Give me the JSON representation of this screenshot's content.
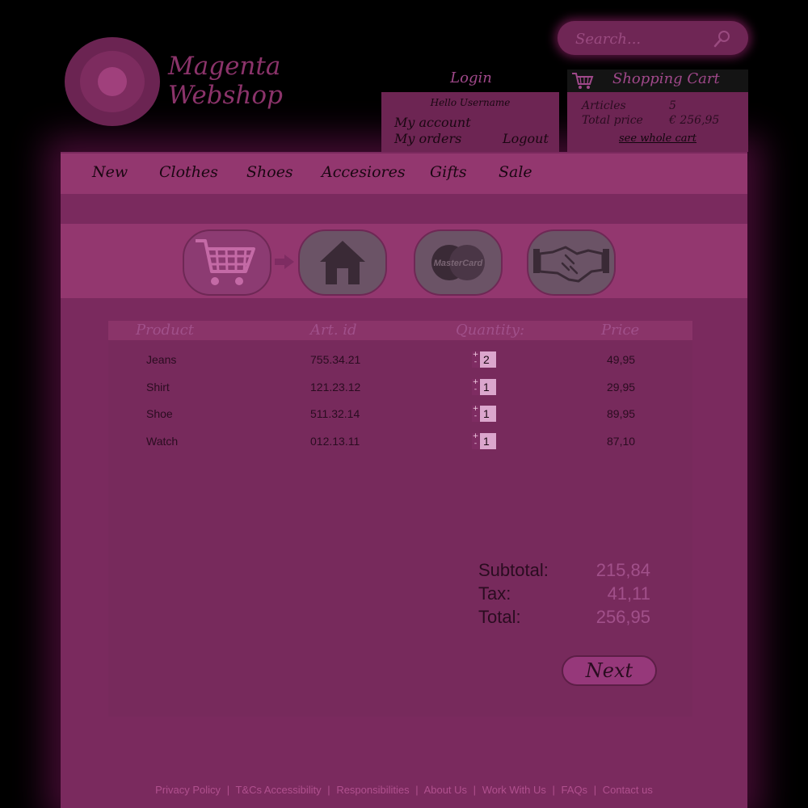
{
  "header": {
    "logo_line1": "Magenta",
    "logo_line2": "Webshop",
    "search_placeholder": "Search..."
  },
  "login": {
    "title": "Login",
    "greeting": "Hello Username",
    "my_account": "My account",
    "my_orders": "My orders",
    "logout": "Logout"
  },
  "cart": {
    "title": "Shopping Cart",
    "articles_label": "Articles",
    "articles_value": "5",
    "total_label": "Total price",
    "total_value": "€ 256,95",
    "see_whole_cart": "see whole cart"
  },
  "nav": {
    "items": [
      "New",
      "Clothes",
      "Shoes",
      "Accesiores",
      "Gifts",
      "Sale"
    ]
  },
  "steps": {
    "icons": [
      "cart-icon",
      "house-icon",
      "mastercard-icon",
      "handshake-icon"
    ],
    "card_text": "MasterCard"
  },
  "table": {
    "headers": {
      "product": "Product",
      "art_id": "Art. id",
      "quantity": "Quantity:",
      "price": "Price"
    },
    "rows": [
      {
        "product": "Jeans",
        "art_id": "755.34.21",
        "qty": "2",
        "price": "49,95"
      },
      {
        "product": "Shirt",
        "art_id": "121.23.12",
        "qty": "1",
        "price": "29,95"
      },
      {
        "product": "Shoe",
        "art_id": "511.32.14",
        "qty": "1",
        "price": "89,95"
      },
      {
        "product": "Watch",
        "art_id": "012.13.11",
        "qty": "1",
        "price": "87,10"
      }
    ]
  },
  "totals": {
    "subtotal_label": "Subtotal:",
    "subtotal_value": "215,84",
    "tax_label": "Tax:",
    "tax_value": "41,11",
    "total_label": "Total:",
    "total_value": "256,95"
  },
  "next_label": "Next",
  "footer": {
    "links": [
      "Privacy Policy",
      "T&Cs Accessibility",
      "Responsibilities",
      "About Us",
      "Work With Us",
      "FAQs",
      "Contact us"
    ],
    "separator": "|"
  }
}
